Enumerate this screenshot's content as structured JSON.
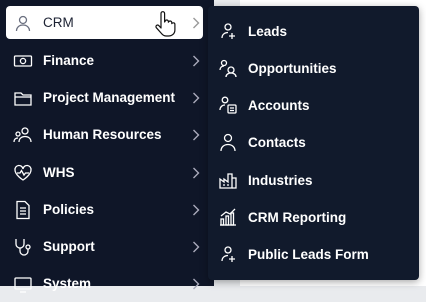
{
  "sidebar": {
    "items": [
      {
        "label": "CRM",
        "icon": "user-icon",
        "active": true
      },
      {
        "label": "Finance",
        "icon": "money-icon"
      },
      {
        "label": "Project Management",
        "icon": "folder-icon"
      },
      {
        "label": "Human Resources",
        "icon": "people-icon"
      },
      {
        "label": "WHS",
        "icon": "heart-pulse-icon"
      },
      {
        "label": "Policies",
        "icon": "document-icon"
      },
      {
        "label": "Support",
        "icon": "stethoscope-icon"
      },
      {
        "label": "System",
        "icon": "system-icon"
      }
    ]
  },
  "submenu": {
    "items": [
      {
        "label": "Leads",
        "icon": "leads-icon"
      },
      {
        "label": "Opportunities",
        "icon": "opportunities-icon"
      },
      {
        "label": "Accounts",
        "icon": "accounts-icon"
      },
      {
        "label": "Contacts",
        "icon": "contact-icon"
      },
      {
        "label": "Industries",
        "icon": "industry-icon"
      },
      {
        "label": "CRM Reporting",
        "icon": "chart-icon"
      },
      {
        "label": "Public Leads Form",
        "icon": "public-leads-icon"
      }
    ]
  },
  "colors": {
    "sidebar_bg": "#0f1628",
    "submenu_bg": "#111a2c",
    "text": "#ffffff",
    "active_bg": "#ffffff"
  }
}
